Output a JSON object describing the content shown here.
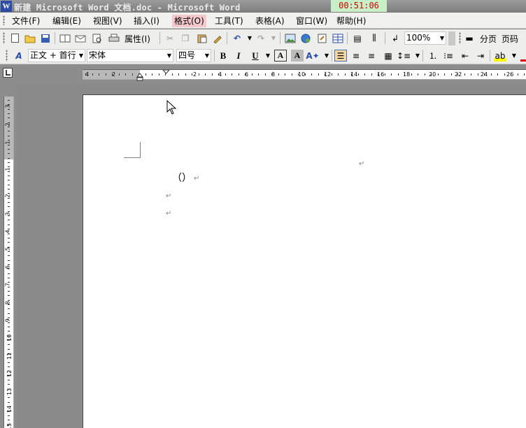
{
  "window": {
    "title": "新建 Microsoft Word 文档.doc - Microsoft Word",
    "timer": "00:51:06"
  },
  "menu": {
    "items": [
      {
        "label": "文件(F)"
      },
      {
        "label": "编辑(E)"
      },
      {
        "label": "视图(V)"
      },
      {
        "label": "插入(I)"
      },
      {
        "label": "格式(O)"
      },
      {
        "label": "工具(T)"
      },
      {
        "label": "表格(A)"
      },
      {
        "label": "窗口(W)"
      },
      {
        "label": "帮助(H)"
      }
    ]
  },
  "standard_toolbar": {
    "properties_label": "属性(I)",
    "zoom": "100%",
    "page_break_label": "分页",
    "page_number_label": "页码"
  },
  "format_toolbar": {
    "style": "正文 + 首行",
    "font": "宋体",
    "size": "四号",
    "bold": "B",
    "italic": "I",
    "underline": "U",
    "char_border": "A",
    "char_shading": "A"
  },
  "ruler": {
    "h_ticks": [
      "4",
      "2",
      "2",
      "4",
      "6",
      "8",
      "10",
      "12",
      "14",
      "16",
      "18",
      "20",
      "22",
      "24",
      "26",
      "28"
    ],
    "v_ticks": [
      "3",
      "2",
      "1",
      "1",
      "2",
      "3",
      "4",
      "5",
      "6",
      "7",
      "8",
      "9",
      "10",
      "11",
      "12",
      "13",
      "14",
      "15"
    ]
  },
  "document": {
    "line1": "（）"
  },
  "icons": {
    "para_mark": "↵"
  }
}
